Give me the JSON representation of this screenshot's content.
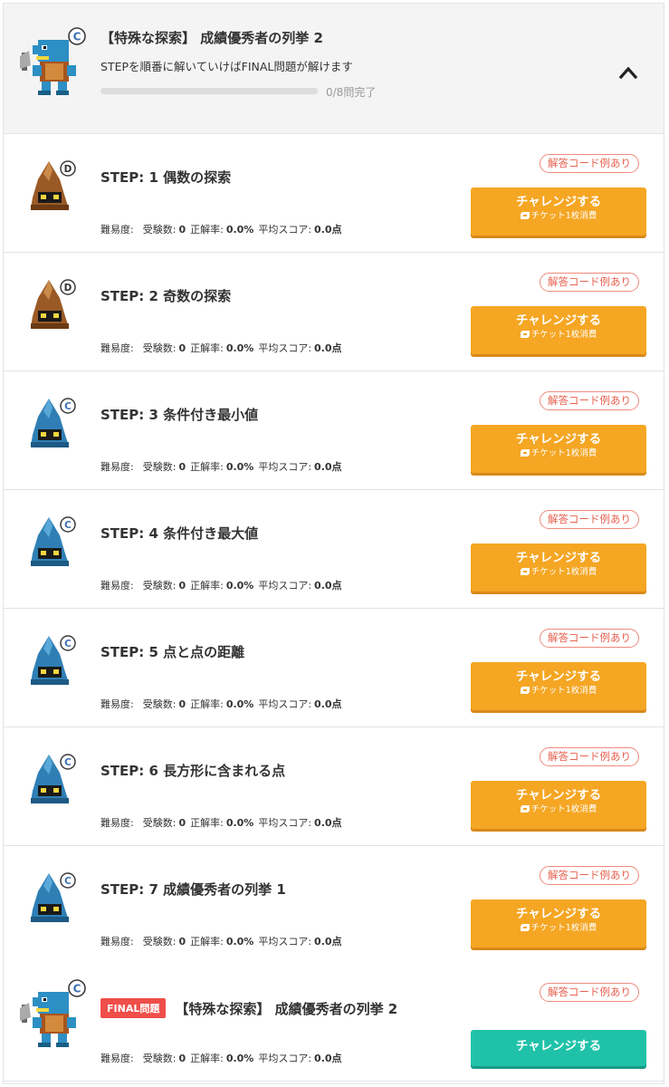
{
  "header": {
    "rank": "C",
    "title": "【特殊な探索】 成績優秀者の列挙 2",
    "description": "STEPを順番に解いていけばFINAL問題が解けます",
    "progress_text": "0/8問完了",
    "progress_fraction": 0.0
  },
  "labels": {
    "difficulty": "難易度:",
    "attempts": "受験数:",
    "accuracy": "正解率:",
    "avg_score": "平均スコア:",
    "code_tag": "解答コード例あり",
    "challenge": "チャレンジする",
    "ticket": "チケット1枚消費",
    "final_badge": "FINAL問題"
  },
  "steps": [
    {
      "rank": "D",
      "title": "STEP: 1 偶数の探索",
      "attempts": "0",
      "accuracy": "0.0%",
      "avg_score": "0.0点"
    },
    {
      "rank": "D",
      "title": "STEP: 2 奇数の探索",
      "attempts": "0",
      "accuracy": "0.0%",
      "avg_score": "0.0点"
    },
    {
      "rank": "C",
      "title": "STEP: 3 条件付き最小値",
      "attempts": "0",
      "accuracy": "0.0%",
      "avg_score": "0.0点"
    },
    {
      "rank": "C",
      "title": "STEP: 4 条件付き最大値",
      "attempts": "0",
      "accuracy": "0.0%",
      "avg_score": "0.0点"
    },
    {
      "rank": "C",
      "title": "STEP: 5 点と点の距離",
      "attempts": "0",
      "accuracy": "0.0%",
      "avg_score": "0.0点"
    },
    {
      "rank": "C",
      "title": "STEP: 6 長方形に含まれる点",
      "attempts": "0",
      "accuracy": "0.0%",
      "avg_score": "0.0点"
    },
    {
      "rank": "C",
      "title": "STEP: 7 成績優秀者の列挙 1",
      "attempts": "0",
      "accuracy": "0.0%",
      "avg_score": "0.0点"
    }
  ],
  "final": {
    "rank": "C",
    "title": "【特殊な探索】 成績優秀者の列挙 2",
    "attempts": "0",
    "accuracy": "0.0%",
    "avg_score": "0.0点"
  },
  "colors": {
    "challenge_orange": "#f5a623",
    "challenge_teal": "#1fc2a8",
    "code_tag_red": "#e8604f",
    "final_badge_red": "#ef4e4a",
    "monster_brown": "#9a5a26",
    "monster_blue": "#2f7fb5"
  },
  "icons": {
    "collapse": "chevron-up-icon",
    "ticket": "ticket-icon",
    "header_avatar": "lizard-warrior-icon",
    "rank_d_avatar": "brown-hood-monster-icon",
    "rank_c_avatar": "blue-hood-monster-icon"
  }
}
